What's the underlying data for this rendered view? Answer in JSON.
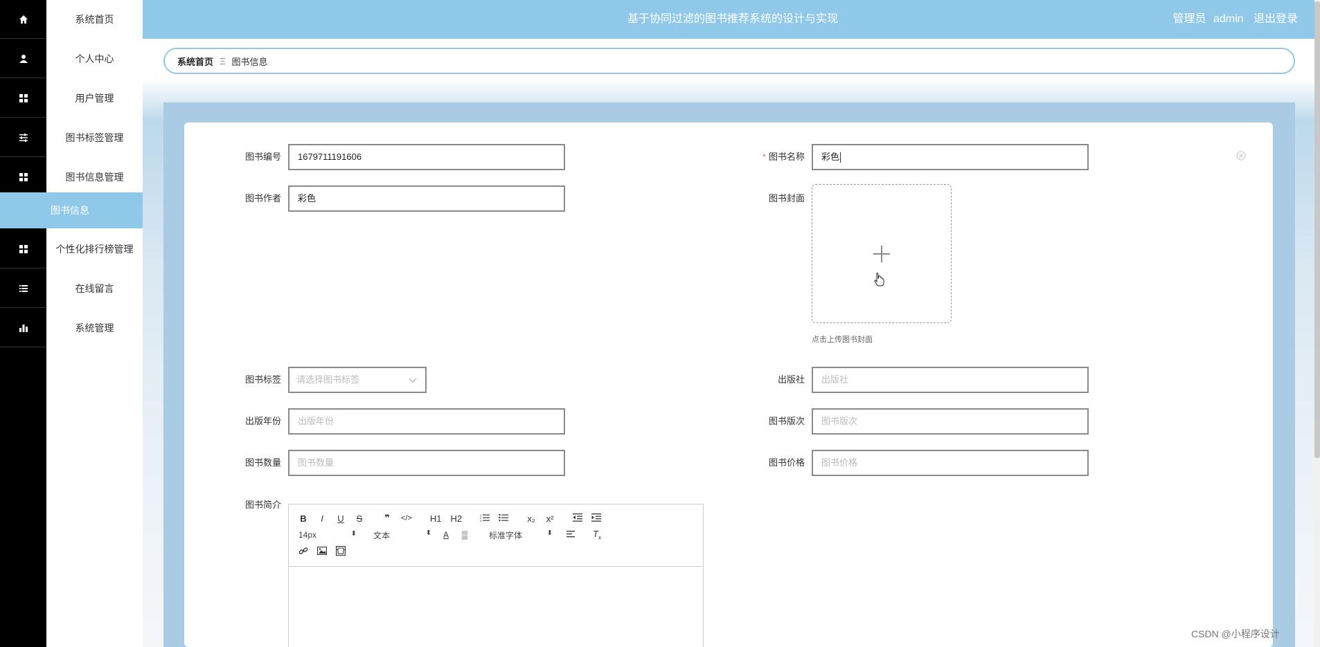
{
  "header": {
    "title": "基于协同过滤的图书推荐系统的设计与实现",
    "role": "管理员",
    "username": "admin",
    "logout": "退出登录"
  },
  "sidebar": {
    "items": [
      {
        "label": "系统首页",
        "icon": "home-icon"
      },
      {
        "label": "个人中心",
        "icon": "user-icon"
      },
      {
        "label": "用户管理",
        "icon": "grid-icon"
      },
      {
        "label": "图书标签管理",
        "icon": "sliders-icon"
      },
      {
        "label": "图书信息管理",
        "icon": "grid-icon"
      },
      {
        "label": "个性化排行榜管理",
        "icon": "grid-icon"
      },
      {
        "label": "在线留言",
        "icon": "list-icon"
      },
      {
        "label": "系统管理",
        "icon": "bar-chart-icon"
      }
    ],
    "active_sub": "图书信息"
  },
  "breadcrumb": {
    "home": "系统首页",
    "separator": "Ξ",
    "current": "图书信息"
  },
  "form": {
    "book_no": {
      "label": "图书编号",
      "value": "1679711191606"
    },
    "book_name": {
      "label": "图书名称",
      "value": "彩色",
      "required_mark": "*"
    },
    "author": {
      "label": "图书作者",
      "value": "彩色"
    },
    "cover": {
      "label": "图书封面",
      "tip": "点击上传图书封面"
    },
    "tag": {
      "label": "图书标签",
      "placeholder": "请选择图书标签"
    },
    "publisher": {
      "label": "出版社",
      "placeholder": "出版社"
    },
    "year": {
      "label": "出版年份",
      "placeholder": "出版年份"
    },
    "edition": {
      "label": "图书版次",
      "placeholder": "图书版次"
    },
    "quantity": {
      "label": "图书数量",
      "placeholder": "图书数量"
    },
    "price": {
      "label": "图书价格",
      "placeholder": "图书价格"
    },
    "intro": {
      "label": "图书简介"
    }
  },
  "editor": {
    "row1": [
      "B",
      "I",
      "U",
      "S",
      "❞",
      "</>",
      "H1",
      "H2",
      "ol",
      "ul",
      "x₂",
      "x²",
      "outdent",
      "indent"
    ],
    "font_size": "14px",
    "heading": "文本",
    "font_family": "标准字体"
  },
  "colors": {
    "accent": "#8fc8e8",
    "sidebar_icon_bg": "#000000",
    "required": "#f56c6c"
  },
  "watermark": "CSDN @小程序设计"
}
